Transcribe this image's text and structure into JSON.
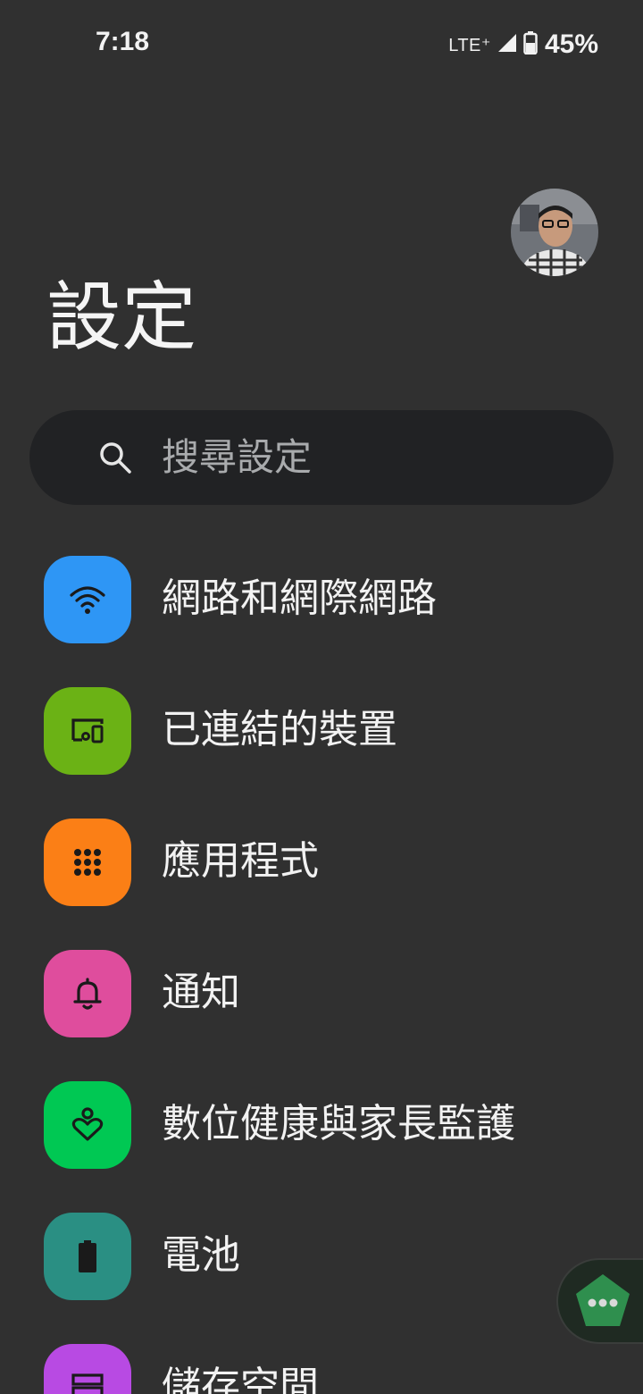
{
  "status_bar": {
    "time": "7:18",
    "network": "LTE⁺",
    "battery_percent": "45%"
  },
  "header": {
    "title": "設定"
  },
  "search": {
    "placeholder": "搜尋設定"
  },
  "settings": {
    "items": [
      {
        "label": "網路和網際網路",
        "icon": "wifi-icon",
        "color": "#2e96f5"
      },
      {
        "label": "已連結的裝置",
        "icon": "connected-devices-icon",
        "color": "#6bb215"
      },
      {
        "label": "應用程式",
        "icon": "apps-grid-icon",
        "color": "#fb7f16"
      },
      {
        "label": "通知",
        "icon": "bell-icon",
        "color": "#df4d9d"
      },
      {
        "label": "數位健康與家長監護",
        "icon": "digital-wellbeing-icon",
        "color": "#00c853"
      },
      {
        "label": "電池",
        "icon": "battery-icon",
        "color": "#2a8f83"
      },
      {
        "label": "儲存空間",
        "icon": "storage-icon",
        "color": "#b84ae3"
      }
    ]
  },
  "colors": {
    "background": "#303030",
    "search_background": "#212224"
  }
}
